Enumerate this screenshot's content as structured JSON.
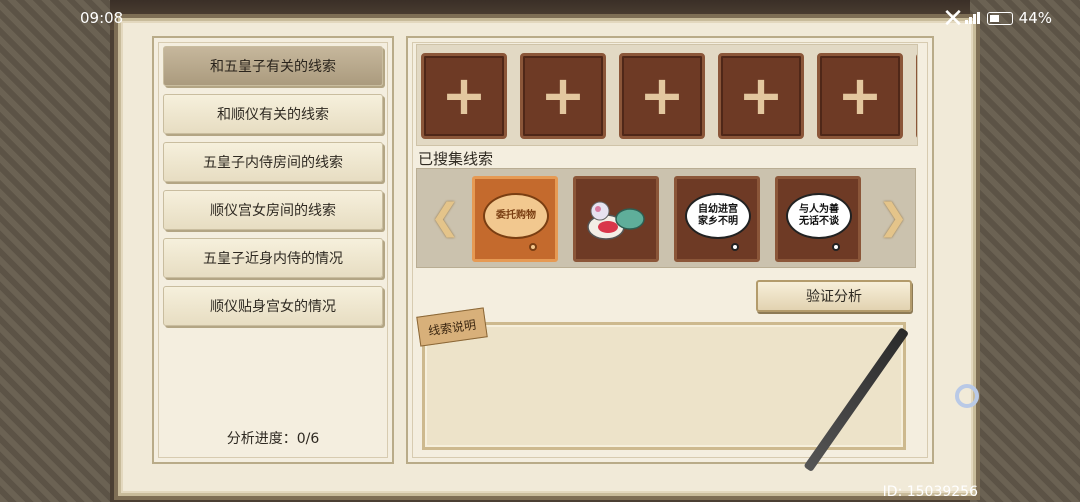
{
  "status_bar": {
    "time": "09:08",
    "battery": "44%"
  },
  "sidebar": {
    "items": [
      {
        "label": "和五皇子有关的线索",
        "active": true
      },
      {
        "label": "和顺仪有关的线索",
        "active": false
      },
      {
        "label": "五皇子内侍房间的线索",
        "active": false
      },
      {
        "label": "顺仪宫女房间的线索",
        "active": false
      },
      {
        "label": "五皇子近身内侍的情况",
        "active": false
      },
      {
        "label": "顺仪贴身宫女的情况",
        "active": false
      }
    ],
    "progress_label": "分析进度：0/6"
  },
  "slots": {
    "count_visible": 5,
    "icon": "plus-icon"
  },
  "collected": {
    "title": "已搜集线索",
    "cards": [
      {
        "text": "委托购物",
        "selected": true
      },
      {
        "text": "",
        "icon": "cosmetics-icon",
        "selected": false
      },
      {
        "text": "自幼进宫\n家乡不明",
        "selected": false
      },
      {
        "text": "与人为善\n无话不谈",
        "selected": false
      }
    ]
  },
  "actions": {
    "verify_label": "验证分析"
  },
  "description": {
    "label": "线索说明",
    "text": ""
  },
  "footer": {
    "user_id": "ID: 15039256"
  },
  "colors": {
    "slot_bg": "#6e3a25",
    "panel_bg": "#f1ead8",
    "selected_card": "#c46a2d"
  }
}
